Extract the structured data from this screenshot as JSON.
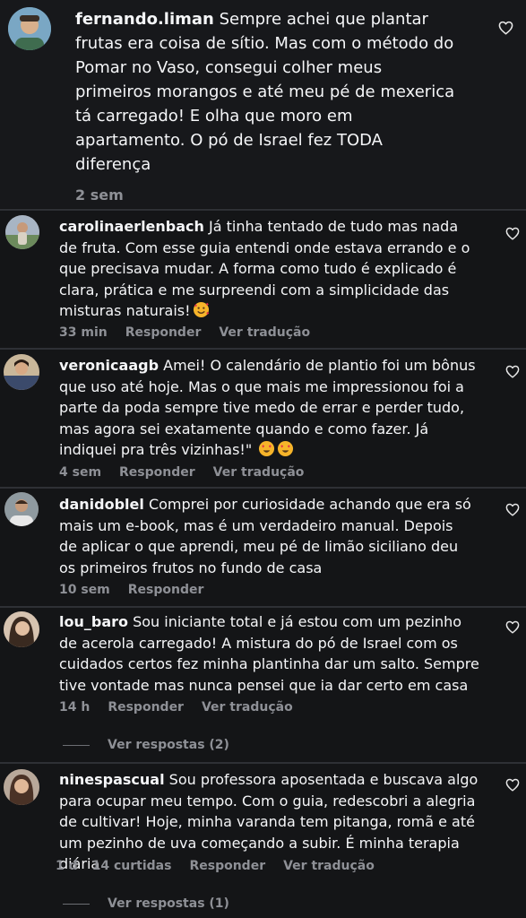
{
  "comments": [
    {
      "username": "fernando.liman",
      "text": "Sempre achei que plantar frutas era coisa de sítio. Mas com o método do Pomar no Vaso, consegui colher meus primeiros morangos e até meu pé de mexerica tá carregado! E olha que moro em apartamento. O pó de Israel fez TODA diferença",
      "time": "2 sem"
    },
    {
      "username": "carolinaerlenbach",
      "text": "Já tinha tentado de tudo mas nada de fruta. Com esse guia entendi onde estava errando e o que precisava mudar. A forma como tudo é explicado é clara, prática e me surpreendi com a simplicidade das misturas naturais!",
      "emoji": "smiling-face-with-hearts",
      "time": "33 min",
      "reply": "Responder",
      "translate": "Ver tradução"
    },
    {
      "username": "veronicaagb",
      "text": "Amei! O calendário de plantio foi um bônus que uso até hoje. Mas o que mais me impressionou foi a parte da poda sempre tive medo de errar e perder tudo, mas agora sei exatamente quando e como fazer. Já indiquei pra três vizinhas!\"",
      "emoji": "heart-eyes",
      "time": "4 sem",
      "reply": "Responder",
      "translate": "Ver tradução"
    },
    {
      "username": "danidoblel",
      "text": "Comprei por curiosidade achando que era só mais um e-book, mas é um verdadeiro manual. Depois de aplicar o que aprendi, meu pé de limão siciliano deu os primeiros frutos no fundo de casa",
      "time": "10 sem",
      "reply": "Responder"
    },
    {
      "username": "lou_baro",
      "text": "Sou iniciante total e já estou com um pezinho de acerola carregado! A mistura do pó de Israel com os cuidados certos fez minha plantinha dar um salto. Sempre tive vontade mas nunca pensei que ia dar certo em casa",
      "time": "14 h",
      "reply": "Responder",
      "translate": "Ver tradução",
      "view_replies": "Ver respostas (2)"
    },
    {
      "username": "ninespascual",
      "text": "Sou professora aposentada e buscava algo para ocupar meu tempo. Com o guia, redescobri a alegria de cultivar! Hoje, minha varanda tem pitanga, romã e até um pezinho de uva começando a subir. É minha terapia diária",
      "time": "1 d",
      "likes": "14 curtidas",
      "reply": "Responder",
      "translate": "Ver tradução",
      "view_replies": "Ver respostas (1)"
    }
  ],
  "colors": {
    "background": "#141517",
    "text": "#f5f6f8",
    "meta": "#8e9096",
    "separator": "#2e3035"
  },
  "icons": {
    "like": "heart-outline-icon"
  }
}
